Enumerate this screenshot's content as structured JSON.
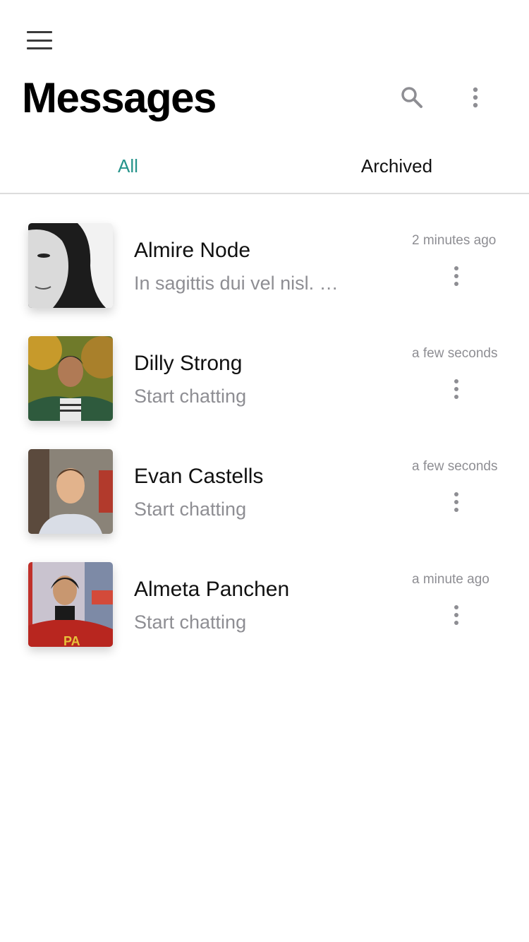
{
  "header": {
    "menu_icon": "hamburger-menu-icon",
    "title": "Messages",
    "search_icon": "search-icon",
    "more_icon": "more-vertical-icon"
  },
  "tabs": [
    {
      "label": "All",
      "active": true
    },
    {
      "label": "Archived",
      "active": false
    }
  ],
  "colors": {
    "accent": "#26948b",
    "muted_text": "#8e8e93",
    "icon_gray": "#3b3b3b"
  },
  "conversations": [
    {
      "name": "Almire Node",
      "preview": "In sagittis dui vel nisl. D...",
      "time": "2 minutes ago"
    },
    {
      "name": "Dilly Strong",
      "preview": "Start chatting",
      "time": "a few seconds ago"
    },
    {
      "name": "Evan Castells",
      "preview": "Start chatting",
      "time": "a few seconds ago"
    },
    {
      "name": "Almeta Panchen",
      "preview": "Start chatting",
      "time": "a minute ago"
    }
  ]
}
